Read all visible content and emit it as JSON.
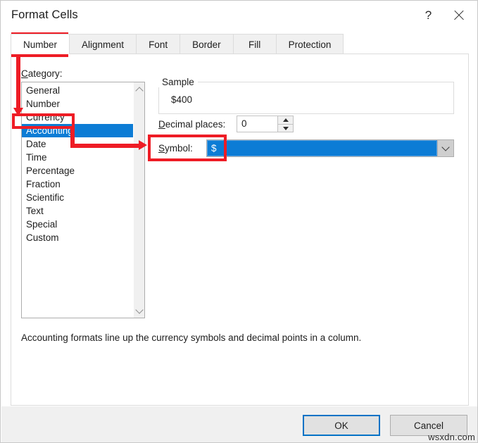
{
  "window": {
    "title": "Format Cells",
    "help_label": "?",
    "close_label": "close-icon"
  },
  "tabs": [
    {
      "label": "Number",
      "active": true
    },
    {
      "label": "Alignment",
      "active": false
    },
    {
      "label": "Font",
      "active": false
    },
    {
      "label": "Border",
      "active": false
    },
    {
      "label": "Fill",
      "active": false
    },
    {
      "label": "Protection",
      "active": false
    }
  ],
  "category": {
    "label": "Category:",
    "items": [
      "General",
      "Number",
      "Currency",
      "Accounting",
      "Date",
      "Time",
      "Percentage",
      "Fraction",
      "Scientific",
      "Text",
      "Special",
      "Custom"
    ],
    "selected": "Accounting",
    "selected_index": 3
  },
  "sample": {
    "group_title": "Sample",
    "value": "$400"
  },
  "decimal_places": {
    "label": "Decimal places:",
    "value": "0",
    "up_label": "increase-decimal",
    "down_label": "decrease-decimal"
  },
  "symbol": {
    "label": "Symbol:",
    "value": "$",
    "dropdown_label": "open-symbol-list"
  },
  "description": "Accounting formats line up the currency symbols and decimal points in a column.",
  "footer": {
    "ok_label": "OK",
    "cancel_label": "Cancel"
  },
  "watermark": "wsxdn.com",
  "colors": {
    "selection_blue": "#0c7cd5",
    "annotation_red": "#ee1c25",
    "focus_blue": "#0072c6",
    "footer_gray": "#f0f0f0"
  }
}
